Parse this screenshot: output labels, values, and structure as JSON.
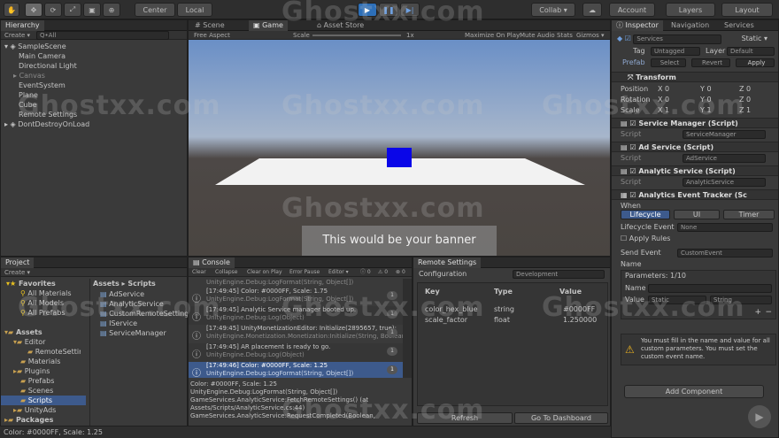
{
  "toolbar": {
    "pivot": "Center",
    "space": "Local",
    "collab": "Collab ▾",
    "account": "Account",
    "layers": "Layers",
    "layout": "Layout"
  },
  "hierarchy": {
    "tab": "Hierarchy",
    "create": "Create ▾",
    "search": "Q•All",
    "scene": "SampleScene",
    "items": [
      "Main Camera",
      "Directional Light",
      "Canvas",
      "EventSystem",
      "Plane",
      "Cube",
      "Remote Settings"
    ],
    "dont_destroy": "DontDestroyOnLoad"
  },
  "scene_tabs": {
    "scene": "Scene",
    "game": "Game",
    "asset_store": "Asset Store"
  },
  "game_bar": {
    "aspect": "Free Aspect",
    "scale_label": "Scale",
    "scale_value": "1x",
    "maximize": "Maximize On Play",
    "mute": "Mute Audio",
    "stats": "Stats",
    "gizmos": "Gizmos ▾"
  },
  "game": {
    "banner": "This would be your banner"
  },
  "project": {
    "tab": "Project",
    "create": "Create ▾",
    "favorites": "Favorites",
    "fav_items": [
      "All Materials",
      "All Models",
      "All Prefabs"
    ],
    "assets": "Assets",
    "tree": [
      "Editor",
      "RemoteSettin",
      "Materials",
      "Plugins",
      "Prefabs",
      "Scenes",
      "Scripts",
      "UnityAds",
      "Packages"
    ],
    "breadcrumb": "Assets ▸ Scripts",
    "files": [
      "AdService",
      "AnalyticService",
      "CustomRemoteSettings",
      "IService",
      "ServiceManager"
    ]
  },
  "console": {
    "tab": "Console",
    "buttons": [
      "Clear",
      "Collapse",
      "Clear on Play",
      "Error Pause",
      "Editor ▾"
    ],
    "counts": [
      "0",
      "0",
      "0"
    ],
    "entries": [
      {
        "l1": "UnityEngine.Debug:LogFormat(String, Object[])",
        "l2": "",
        "n": "1"
      },
      {
        "l1": "[17:49:45] Color: #0000FF, Scale: 1.75",
        "l2": "UnityEngine.Debug:LogFormat(String, Object[])",
        "n": "1"
      },
      {
        "l1": "[17:49:45] Analytic Service manager booted up.",
        "l2": "UnityEngine.Debug:Log(Object)",
        "n": "1"
      },
      {
        "l1": "[17:49:45] UnityMonetizationEditor: Initialize(2895657, true);",
        "l2": "UnityEngine.Monetization.Monetization:Initialize(String, Boolean)",
        "n": "1"
      },
      {
        "l1": "[17:49:45] AR placement is ready to go.",
        "l2": "UnityEngine.Debug:Log(Object)",
        "n": "1"
      },
      {
        "l1": "[17:49:46] Color: #0000FF, Scale: 1.25",
        "l2": "UnityEngine.Debug:LogFormat(String, Object[])",
        "n": "1"
      }
    ],
    "detail": [
      "Color: #0000FF, Scale: 1.25",
      "UnityEngine.Debug:LogFormat(String, Object[])",
      "GameServices.AnalyticService:FetchRemoteSettings() (at",
      "Assets/Scripts/AnalyticService.cs:44)",
      "GameServices.AnalyticService:RequestCompleted(Boolean,"
    ]
  },
  "remote": {
    "tab": "Remote Settings",
    "config_label": "Configuration",
    "config_value": "Development",
    "cols": [
      "Key",
      "Type",
      "Value"
    ],
    "rows": [
      [
        "color_hex_blue",
        "string",
        "#0000FF"
      ],
      [
        "scale_factor",
        "float",
        "1.250000"
      ]
    ],
    "refresh": "Refresh",
    "dashboard": "Go To Dashboard"
  },
  "inspector": {
    "tabs": [
      "Inspector",
      "Navigation",
      "Services"
    ],
    "name": "Services",
    "static": "Static ▾",
    "tag_label": "Tag",
    "tag": "Untagged",
    "layer_label": "Layer",
    "layer": "Default",
    "prefab": "Prefab",
    "select": "Select",
    "revert": "Revert",
    "apply": "Apply",
    "transform": "Transform",
    "pos_label": "Position",
    "rot_label": "Rotation",
    "scale_label": "Scale",
    "pos": [
      "0",
      "0",
      "0"
    ],
    "rot": [
      "0",
      "0",
      "0"
    ],
    "scl": [
      "1",
      "1",
      "1"
    ],
    "components": [
      {
        "title": "Service Manager (Script)",
        "script": "ServiceManager"
      },
      {
        "title": "Ad Service (Script)",
        "script": "AdService"
      },
      {
        "title": "Analytic Service (Script)",
        "script": "AnalyticService"
      }
    ],
    "tracker": "Analytics Event Tracker (Sc",
    "when": "When",
    "tab_lifecycle": "Lifecycle",
    "tab_ui": "UI",
    "tab_timer": "Timer",
    "lifecycle_event": "Lifecycle Event",
    "lifecycle_value": "None",
    "apply_rules": "Apply Rules",
    "send_event": "Send Event",
    "send_value": "CustomEvent",
    "name_label": "Name",
    "params": "Parameters: 1/10",
    "p_name": "Name",
    "p_value": "Value",
    "p_static": "Static",
    "p_string": "String",
    "warning": "You must fill in the name and value for all custom parameters. You must set the custom event name.",
    "add_component": "Add Component"
  },
  "status": "Color: #0000FF, Scale: 1.25",
  "watermark": "Ghostxx.com",
  "colors": {
    "accent": "#3d5a8c",
    "cube": "#0a06e8"
  }
}
